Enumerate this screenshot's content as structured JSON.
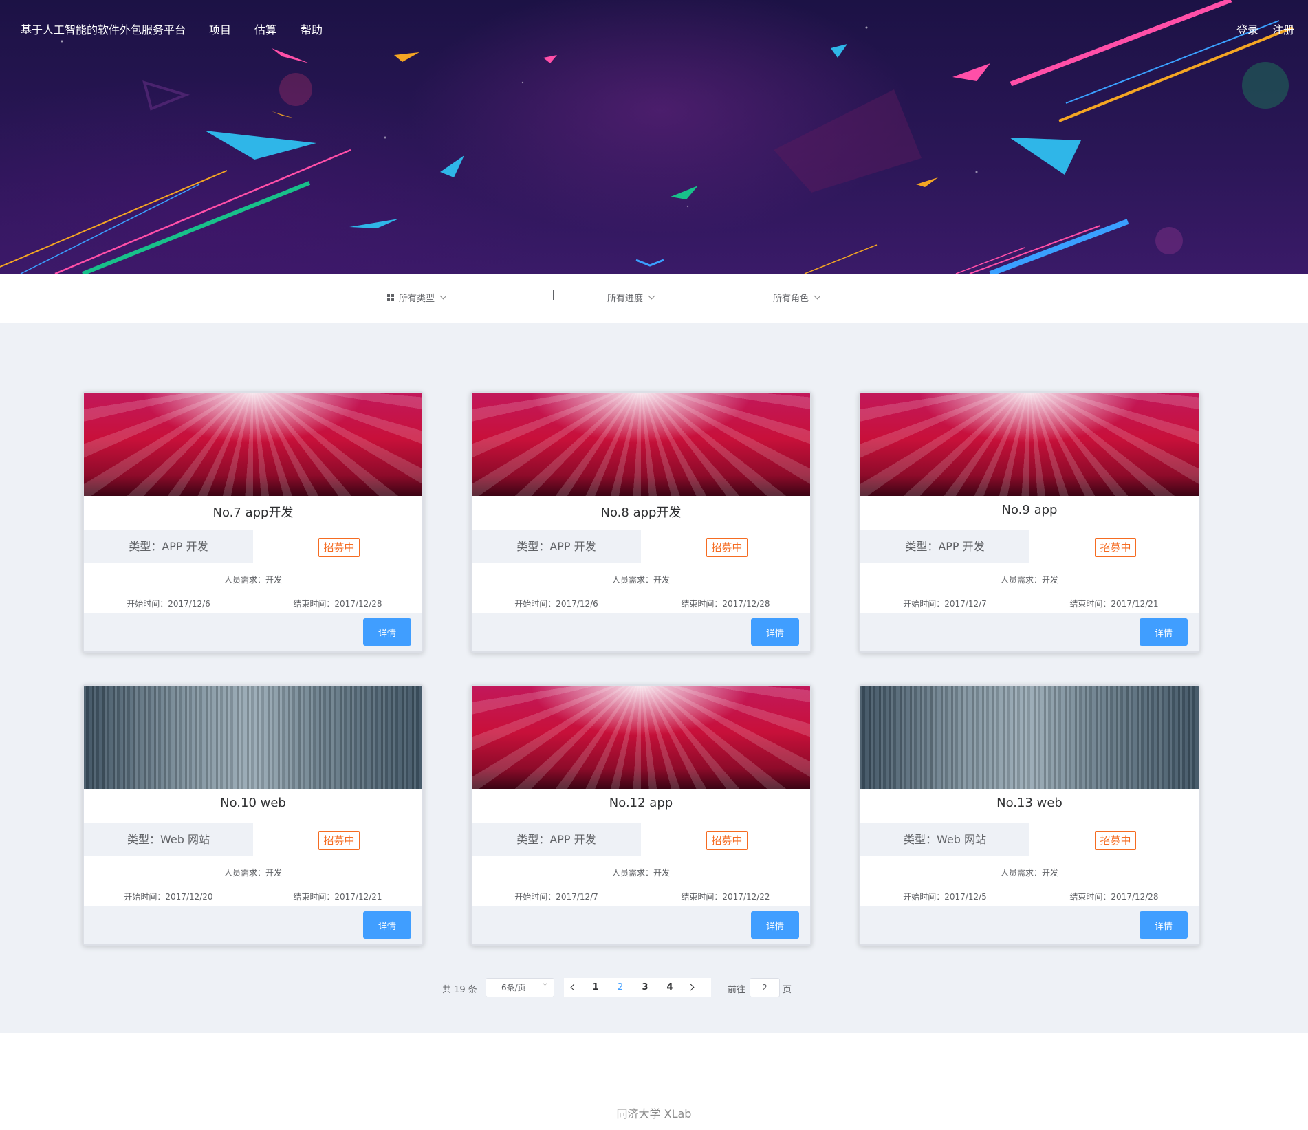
{
  "header": {
    "brand": "基于人工智能的软件外包服务平台",
    "nav": [
      "项目",
      "估算",
      "帮助"
    ],
    "login": "登录",
    "register": "注册"
  },
  "filters": {
    "type": "所有类型",
    "progress": "所有进度",
    "role": "所有角色"
  },
  "cards": [
    {
      "title": "No.7 app开发",
      "type": "类型：APP 开发",
      "status": "招募中",
      "requirement": "人员需求：开发",
      "start": "开始时间：2017/12/6",
      "end": "结束时间：2017/12/28",
      "button": "详情",
      "image": "red-stage"
    },
    {
      "title": "No.8 app开发",
      "type": "类型：APP 开发",
      "status": "招募中",
      "requirement": "人员需求：开发",
      "start": "开始时间：2017/12/6",
      "end": "结束时间：2017/12/28",
      "button": "详情",
      "image": "red-stage"
    },
    {
      "title": "No.9 app",
      "type": "类型：APP 开发",
      "status": "招募中",
      "requirement": "人员需求：开发",
      "start": "开始时间：2017/12/7",
      "end": "结束时间：2017/12/21",
      "button": "详情",
      "image": "red-stage"
    },
    {
      "title": "No.10 web",
      "type": "类型：Web 网站",
      "status": "招募中",
      "requirement": "人员需求：开发",
      "start": "开始时间：2017/12/20",
      "end": "结束时间：2017/12/21",
      "button": "详情",
      "image": "gray-stripes"
    },
    {
      "title": "No.12 app",
      "type": "类型：APP 开发",
      "status": "招募中",
      "requirement": "人员需求：开发",
      "start": "开始时间：2017/12/7",
      "end": "结束时间：2017/12/22",
      "button": "详情",
      "image": "red-stage"
    },
    {
      "title": "No.13 web",
      "type": "类型：Web 网站",
      "status": "招募中",
      "requirement": "人员需求：开发",
      "start": "开始时间：2017/12/5",
      "end": "结束时间：2017/12/28",
      "button": "详情",
      "image": "gray-stripes"
    }
  ],
  "pagination": {
    "total": "共 19 条",
    "page_size": "6条/页",
    "pages": [
      "1",
      "2",
      "3",
      "4"
    ],
    "current": "2",
    "goto_label": "前往",
    "goto_value": "2",
    "page_suffix": "页"
  },
  "footer": {
    "text": "同济大学 XLab"
  },
  "colors": {
    "primary": "#409eff",
    "status": "#f56c22",
    "background": "#eef1f6"
  }
}
